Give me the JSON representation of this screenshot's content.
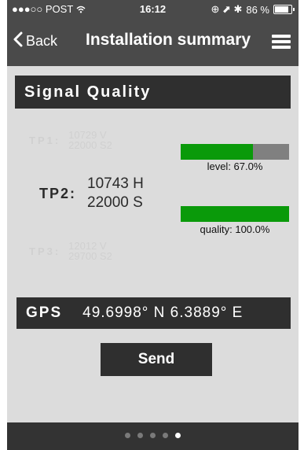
{
  "status_bar": {
    "carrier": "●●●○○ POST",
    "wifi_icon": "wifi-icon",
    "time": "16:12",
    "right_icons": "⊕ ⬈ ✱",
    "battery_percent": "86 %",
    "battery_level": 0.86
  },
  "nav": {
    "back_label": "Back",
    "title": "Installation summary",
    "menu_icon": "hamburger-menu-icon"
  },
  "signal_section": {
    "header": "Signal Quality",
    "tp1": {
      "label": "TP1:",
      "line1": "10729 V",
      "line2": "22000 S2"
    },
    "tp2": {
      "label": "TP2:",
      "line1": "10743 H",
      "line2": "22000 S"
    },
    "tp3": {
      "label": "TP3:",
      "line1": "12012 V",
      "line2": "29700 S2"
    },
    "level": {
      "caption": "level: 67.0%",
      "fraction": 0.67
    },
    "quality": {
      "caption": "quality: 100.0%",
      "fraction": 1.0
    }
  },
  "gps": {
    "label": "GPS",
    "coordinates": "49.6998° N 6.3889° E"
  },
  "send_label": "Send",
  "pager": {
    "count": 5,
    "active_index": 4
  },
  "colors": {
    "bar_fill": "#0a9a0a",
    "bar_track": "#808080",
    "dark_panel": "#2f2f2f",
    "top_bar": "#4a4a4a"
  }
}
